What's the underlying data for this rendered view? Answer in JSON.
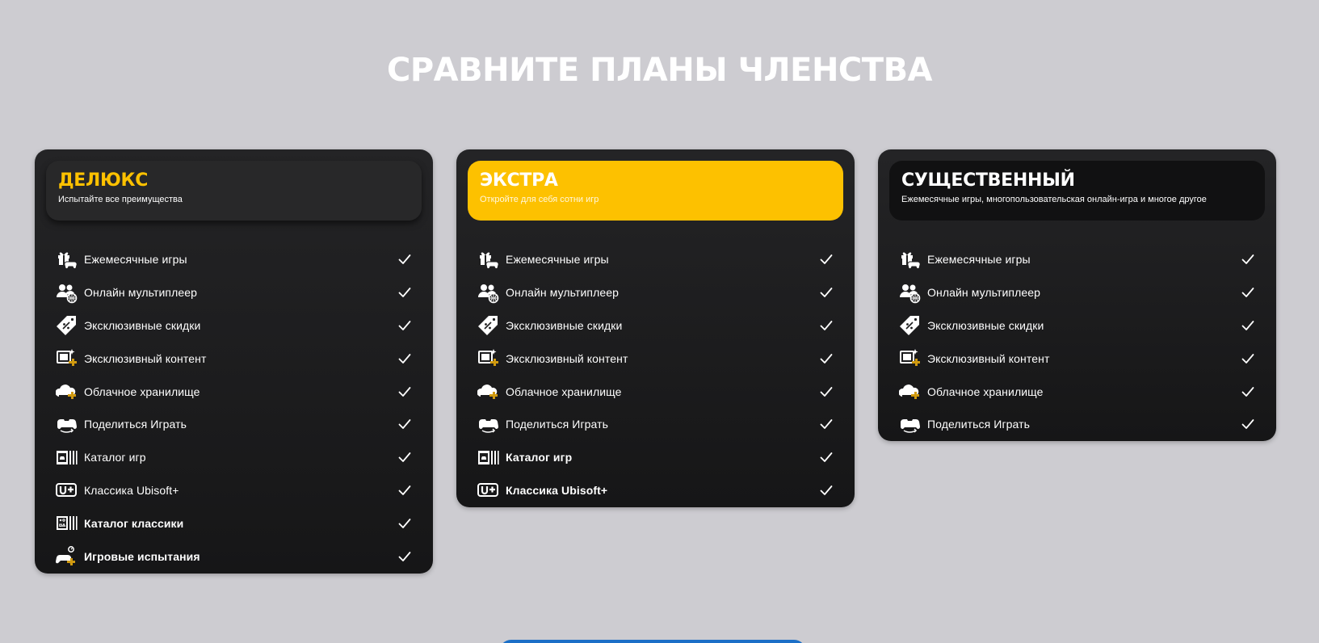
{
  "page": {
    "title": "СРАВНИТЕ ПЛАНЫ ЧЛЕНСТВА"
  },
  "colors": {
    "accent": "#fdc100",
    "card_bg": "#1b1b1c",
    "page_bg": "#cdccd1",
    "cta": "#1b6fc7"
  },
  "plans": [
    {
      "name": "ДЕЛЮКС",
      "subtitle": "Испытайте все преимущества",
      "features": [
        {
          "label": "Ежемесячные игры",
          "icon": "gift-controller-icon",
          "included": true
        },
        {
          "label": "Онлайн мультиплеер",
          "icon": "multiplayer-globe-icon",
          "included": true
        },
        {
          "label": "Эксклюзивные скидки",
          "icon": "discount-tag-icon",
          "included": true
        },
        {
          "label": "Эксклюзивный контент",
          "icon": "exclusive-content-icon",
          "included": true
        },
        {
          "label": "Облачное хранилище",
          "icon": "cloud-storage-icon",
          "included": true
        },
        {
          "label": "Поделиться Играть",
          "icon": "share-play-icon",
          "included": true
        },
        {
          "label": "Каталог игр",
          "icon": "game-catalog-icon",
          "included": true
        },
        {
          "label": "Классика Ubisoft+",
          "icon": "ubisoft-plus-icon",
          "included": true
        },
        {
          "label": "Каталог классики",
          "icon": "classics-catalog-icon",
          "included": true,
          "bold": true
        },
        {
          "label": "Игровые испытания",
          "icon": "game-trials-icon",
          "included": true,
          "bold": true
        }
      ]
    },
    {
      "name": "ЭКСТРА",
      "subtitle": "Откройте для себя сотни игр",
      "features": [
        {
          "label": "Ежемесячные игры",
          "icon": "gift-controller-icon",
          "included": true
        },
        {
          "label": "Онлайн мультиплеер",
          "icon": "multiplayer-globe-icon",
          "included": true
        },
        {
          "label": "Эксклюзивные скидки",
          "icon": "discount-tag-icon",
          "included": true
        },
        {
          "label": "Эксклюзивный контент",
          "icon": "exclusive-content-icon",
          "included": true
        },
        {
          "label": "Облачное хранилище",
          "icon": "cloud-storage-icon",
          "included": true
        },
        {
          "label": "Поделиться Играть",
          "icon": "share-play-icon",
          "included": true
        },
        {
          "label": "Каталог игр",
          "icon": "game-catalog-icon",
          "included": true,
          "bold": true
        },
        {
          "label": "Классика Ubisoft+",
          "icon": "ubisoft-plus-icon",
          "included": true,
          "bold": true
        }
      ]
    },
    {
      "name": "СУЩЕСТВЕННЫЙ",
      "subtitle": "Ежемесячные игры, многопользовательская онлайн-игра и многое другое",
      "features": [
        {
          "label": "Ежемесячные игры",
          "icon": "gift-controller-icon",
          "included": true
        },
        {
          "label": "Онлайн мультиплеер",
          "icon": "multiplayer-globe-icon",
          "included": true
        },
        {
          "label": "Эксклюзивные скидки",
          "icon": "discount-tag-icon",
          "included": true
        },
        {
          "label": "Эксклюзивный контент",
          "icon": "exclusive-content-icon",
          "included": true
        },
        {
          "label": "Облачное хранилище",
          "icon": "cloud-storage-icon",
          "included": true
        },
        {
          "label": "Поделиться Играть",
          "icon": "share-play-icon",
          "included": true
        }
      ]
    }
  ]
}
